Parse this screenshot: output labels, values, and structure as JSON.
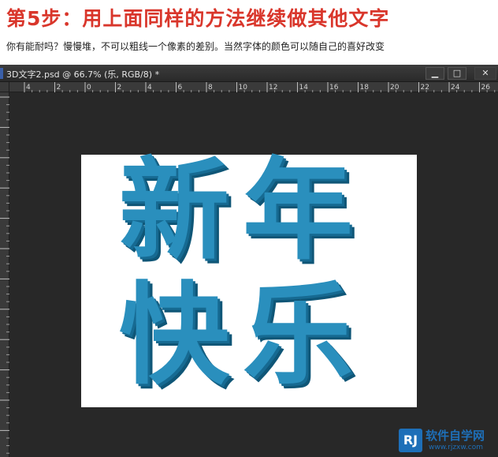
{
  "step": {
    "title": "第5步：用上面同样的方法继续做其他文字",
    "description": "你有能耐吗？慢慢堆，不可以粗线一个像素的差别。当然字体的颜色可以随自己的喜好改变"
  },
  "window": {
    "title": "3D文字2.psd @ 66.7% (乐, RGB/8) *",
    "minimize_label": "▁",
    "maximize_label": "□",
    "close_label": "✕"
  },
  "ruler": {
    "labels": [
      "4",
      "2",
      "0",
      "2",
      "4",
      "6",
      "8",
      "10",
      "12",
      "14",
      "16",
      "18",
      "20",
      "22",
      "24",
      "26"
    ]
  },
  "canvas": {
    "characters": [
      "新",
      "年",
      "快",
      "乐"
    ],
    "text_color": "#2a8fbd",
    "shadow_color": "#166a92"
  },
  "watermark": {
    "badge": "RJ",
    "name": "软件自学网",
    "url": "www.rjzxw.com"
  }
}
